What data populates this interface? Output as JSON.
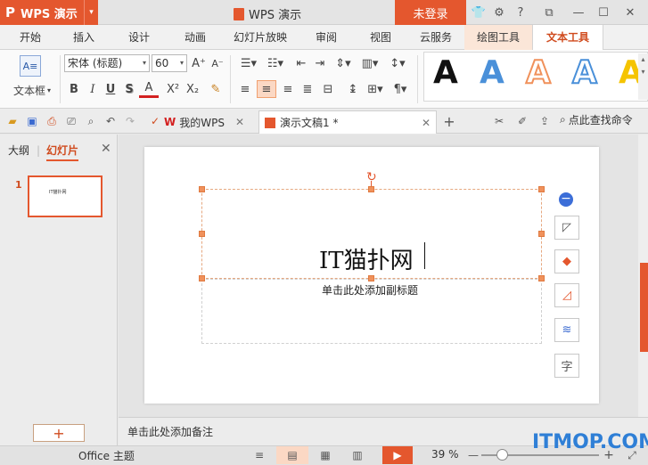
{
  "app": {
    "logo_letter": "P",
    "logo_text": "WPS 演示",
    "doc_title": "WPS 演示",
    "login": "未登录"
  },
  "titlebar_icons": [
    "shirt-icon",
    "settings-icon",
    "help-icon",
    "restore-icon",
    "minimize-icon",
    "maximize-icon",
    "close-icon"
  ],
  "tabs": [
    "开始",
    "插入",
    "设计",
    "动画",
    "幻灯片放映",
    "审阅",
    "视图",
    "云服务",
    "绘图工具",
    "文本工具"
  ],
  "ribbon": {
    "textbox_label": "文本框",
    "font_name": "宋体 (标题)",
    "font_size": "60",
    "bold": "B",
    "italic": "I",
    "underline": "U",
    "shadow": "S",
    "font_color": "A",
    "superscript": "X²",
    "subscript": "X₂",
    "grow": "A⁺",
    "shrink": "A⁻"
  },
  "quickbar": {
    "tab_mywps": "我的WPS",
    "tab_doc": "演示文稿1 *",
    "search_cmd": "点此查找命令"
  },
  "left_panel": {
    "outline": "大纲",
    "slides": "幻灯片",
    "slide_number": "1",
    "thumb_text": "IT猫扑网",
    "add": "+"
  },
  "slide": {
    "title": "IT猫扑网",
    "subtitle": "单击此处添加副标题"
  },
  "notes": "单击此处添加备注",
  "status": {
    "theme": "Office 主题",
    "zoom": "39 %",
    "minus": "—",
    "plus": "+"
  },
  "watermark": "ITMOP.COM",
  "colors": {
    "accent": "#e4572e",
    "art_blue": "#4a90d9",
    "art_orange": "#f0915b",
    "art_yellow": "#f5c400"
  }
}
